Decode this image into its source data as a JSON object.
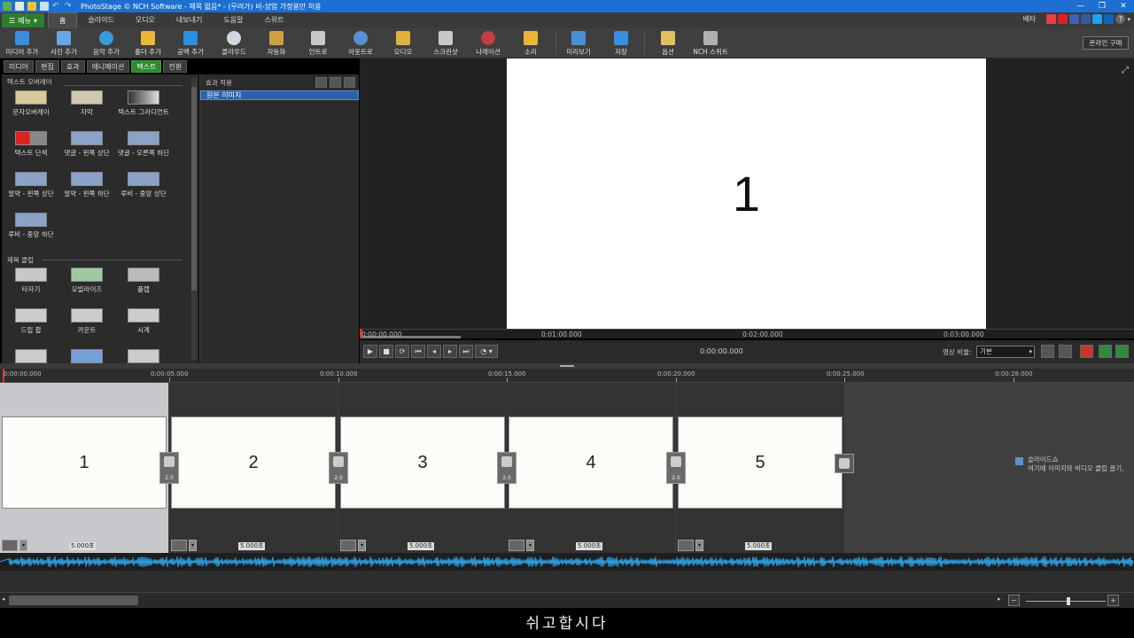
{
  "window": {
    "title": "PhotoStage © NCH Software - 제목 없음* - (무려가) 비-상업 가정용만 허용",
    "controls": [
      "—",
      "❐",
      "✕"
    ]
  },
  "menubar": {
    "menu_button": "메뉴",
    "tabs": [
      "홈",
      "슬라이드",
      "오디오",
      "내보내기",
      "도움말",
      "스위트"
    ],
    "active_tab": "홈",
    "beta": "베타"
  },
  "toolbar": {
    "items": [
      {
        "label": "미디어 추가",
        "icon": "media-add-icon",
        "color": "#3a8de0"
      },
      {
        "label": "사진 추가",
        "icon": "photo-add-icon",
        "color": "#6aa6e6"
      },
      {
        "label": "음악 추가",
        "icon": "music-add-icon",
        "color": "#3a9adb"
      },
      {
        "label": "폴더 추가",
        "icon": "folder-add-icon",
        "color": "#e8b73a"
      },
      {
        "label": "공백 추가",
        "icon": "blank-add-icon",
        "color": "#2a8fe0"
      },
      {
        "label": "클라우드",
        "icon": "cloud-icon",
        "color": "#cfd8e0"
      },
      {
        "label": "자동화",
        "icon": "wand-icon",
        "color": "#d0a040"
      },
      {
        "label": "인트로",
        "icon": "clapper-icon",
        "color": "#c8c8c8"
      },
      {
        "label": "아웃트로",
        "icon": "disc-icon",
        "color": "#5a8fd0"
      },
      {
        "label": "오디오",
        "icon": "audio-icon",
        "color": "#e0b040"
      },
      {
        "label": "스크린샷",
        "icon": "camera-icon",
        "color": "#c8c8c8"
      },
      {
        "label": "나레이션",
        "icon": "microphone-icon",
        "color": "#c04040"
      },
      {
        "label": "소리",
        "icon": "sound-icon",
        "color": "#e8b73a"
      },
      {
        "label": "미리보기",
        "icon": "preview-icon",
        "color": "#4a90d8"
      },
      {
        "label": "저장",
        "icon": "save-icon",
        "color": "#3a8de0"
      },
      {
        "label": "옵션",
        "icon": "options-icon",
        "color": "#e0c060"
      },
      {
        "label": "NCH 스위트",
        "icon": "nch-suite-icon",
        "color": "#b0b0b0"
      }
    ],
    "buy_label": "온라인 구매"
  },
  "left_tabs": [
    "미디어",
    "편집",
    "효과",
    "애니메이션",
    "텍스트",
    "전환"
  ],
  "left_active_tab": "텍스트",
  "text_overlay": {
    "title": "텍스트 오버레이",
    "items": [
      "문자오버레이",
      "자막",
      "텍스트 그라디언트",
      "텍스트 단색",
      "댓글 - 왼쪽 상단",
      "댓글 - 오른쪽 하단",
      "알약 - 왼쪽 상단",
      "알약 - 왼쪽 하단",
      "루비 - 중앙 상단",
      "루비 - 중앙 하단"
    ]
  },
  "title_clips": {
    "title": "제목 클립",
    "items": [
      "타자기",
      "모빌라이즈",
      "플랩",
      "드립 팝",
      "카운트",
      "시계"
    ]
  },
  "effects_panel": {
    "title": "효과 적용",
    "row": "원본 이미지"
  },
  "preview": {
    "slide_text": "1",
    "ruler": [
      "0:00:00.000",
      "0:01:00.000",
      "0:02:00.000",
      "0:03:00.000"
    ],
    "time": "0:00:00.000",
    "ratio_label": "영상 비율:",
    "ratio_value": "기본"
  },
  "timeline": {
    "ruler": [
      "0:00:00.000",
      "0:00:05.000",
      "0:00:10.000",
      "0:00:15.000",
      "0:00:20.000",
      "0:00:25.000",
      "0:00:28.000"
    ],
    "slides": [
      {
        "text": "1",
        "duration": "5.000초"
      },
      {
        "text": "2",
        "duration": "5.000초"
      },
      {
        "text": "3",
        "duration": "5.000초"
      },
      {
        "text": "4",
        "duration": "5.000초"
      },
      {
        "text": "5",
        "duration": "5.000초"
      }
    ],
    "transition_value": "2.0",
    "hint_title": "슬라이드쇼",
    "hint_text": "여기에 이미지와 비디오 클립 끌기,"
  },
  "caption": "쉬고합시다",
  "colors": {
    "accent_green": "#2c8a2c",
    "title_blue": "#1d6fd1",
    "waveform": "#2ea3e6",
    "selection_blue": "#2f5fa8"
  }
}
